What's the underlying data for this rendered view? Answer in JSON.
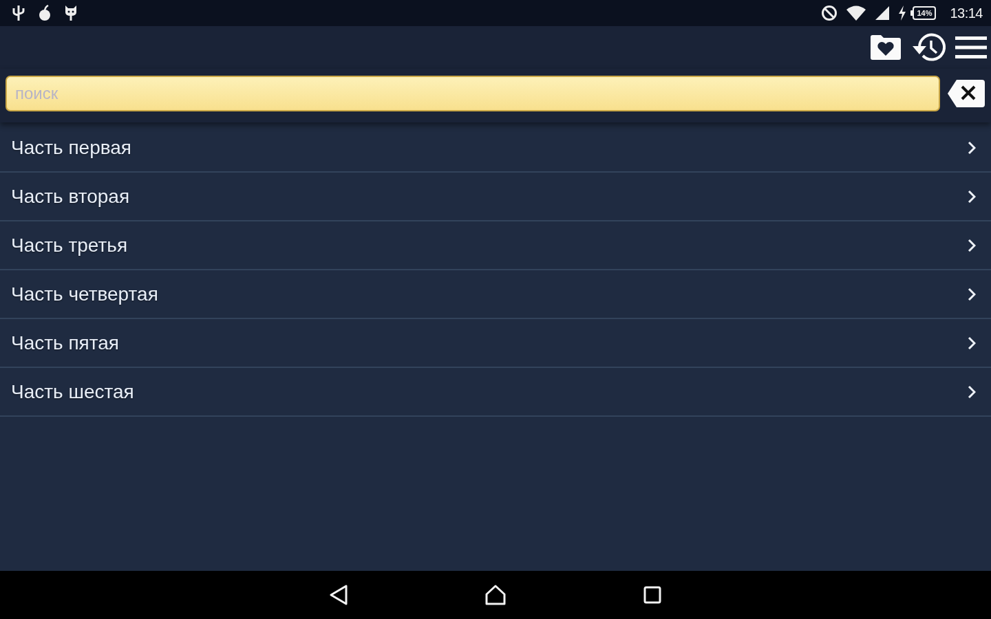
{
  "status_bar": {
    "battery": "14%",
    "time": "13:14"
  },
  "search": {
    "placeholder": "поиск"
  },
  "items": [
    {
      "label": "Часть первая"
    },
    {
      "label": "Часть вторая"
    },
    {
      "label": "Часть третья"
    },
    {
      "label": "Часть четвертая"
    },
    {
      "label": "Часть пятая"
    },
    {
      "label": "Часть шестая"
    }
  ]
}
